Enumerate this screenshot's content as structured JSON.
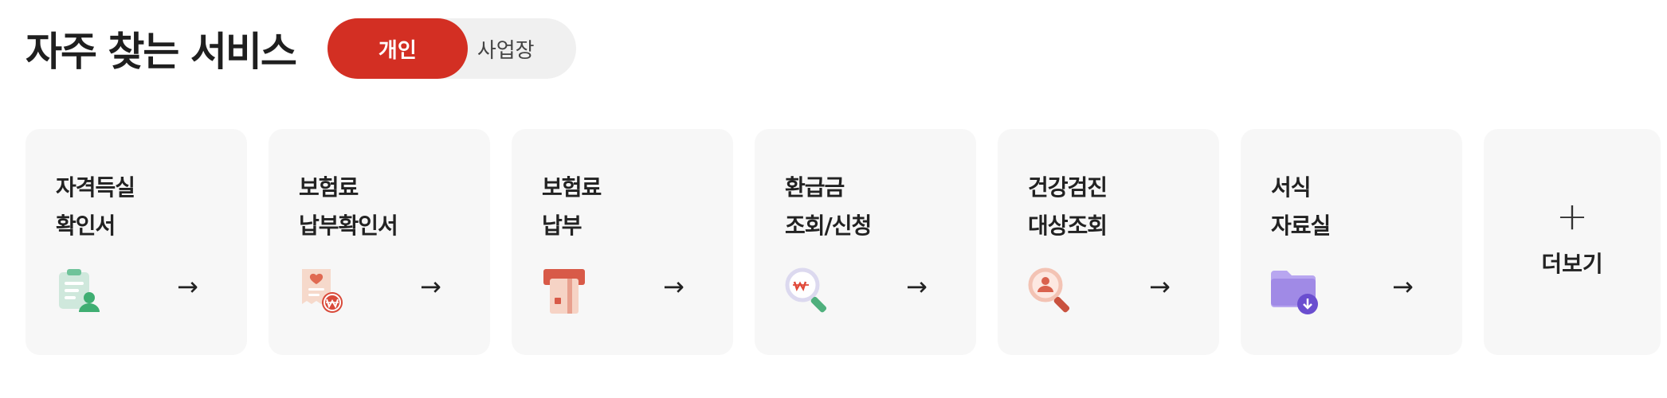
{
  "header": {
    "title": "자주 찾는 서비스",
    "toggle": {
      "personal": "개인",
      "business": "사업장",
      "selected": "개인"
    }
  },
  "colors": {
    "accent": "#d32f23",
    "card_bg": "#f7f7f7",
    "toggle_bg": "#f0f0f0"
  },
  "services": [
    {
      "line1": "자격득실",
      "line2": "확인서",
      "icon": "qualification-doc-user-icon"
    },
    {
      "line1": "보험료",
      "line2": "납부확인서",
      "icon": "premium-receipt-won-icon"
    },
    {
      "line1": "보험료",
      "line2": "납부",
      "icon": "card-payment-icon"
    },
    {
      "line1": "환급금",
      "line2": "조회/신청",
      "icon": "refund-search-icon"
    },
    {
      "line1": "건강검진",
      "line2": "대상조회",
      "icon": "checkup-user-search-icon"
    },
    {
      "line1": "서식",
      "line2": "자료실",
      "icon": "folder-download-icon"
    }
  ],
  "arrow": "→",
  "more": {
    "plus": "+",
    "label": "더보기"
  }
}
